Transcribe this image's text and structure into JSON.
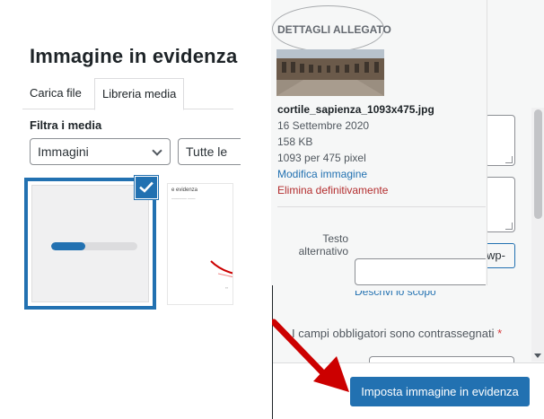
{
  "media_modal": {
    "title": "Immagine in evidenza",
    "tabs": [
      {
        "label": "Carica file"
      },
      {
        "label": "Libreria media"
      }
    ],
    "filter_label": "Filtra i media",
    "type_filter": {
      "selected": "Immagini"
    },
    "date_filter": {
      "selected": "Tutte le"
    },
    "upload_progress": 0.4,
    "doc_thumbnail": {
      "title": "e evidenza"
    }
  },
  "attachment_details": {
    "heading": "DETTAGLI ALLEGATO",
    "file_name": "cortile_sapienza_1093x475.jpg",
    "date": "16 Settembre 2020",
    "file_size": "158 KB",
    "dimensions": "1093 per 475 pixel",
    "edit_link": "Modifica immagine",
    "delete_link": "Elimina definitivamente",
    "alt_text_label": "Testo alternativo",
    "alt_text_value": "",
    "alt_help_link": "Descrivi lo scopo"
  },
  "settings_panel": {
    "wp_button_label": "wp-",
    "required_note": "I campi obbligatori sono contrassegnati",
    "required_marker": "*"
  },
  "toolbar": {
    "primary_button": "Imposta immagine in evidenza"
  },
  "colors": {
    "accent": "#2271b1",
    "danger": "#b32d2e",
    "arrow": "#cc0000"
  }
}
